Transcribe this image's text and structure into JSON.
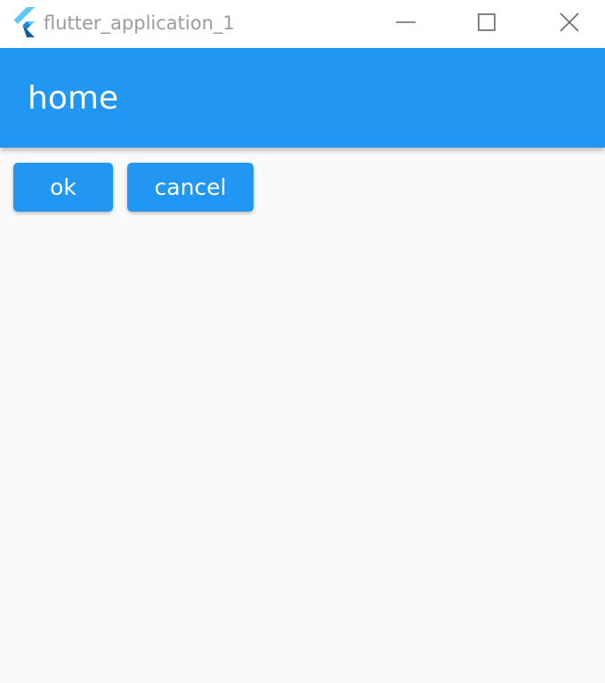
{
  "window": {
    "title": "flutter_application_1",
    "icon": "flutter-logo-icon",
    "controls": [
      "minimize-icon",
      "maximize-icon",
      "close-icon"
    ]
  },
  "appbar": {
    "title": "home"
  },
  "buttons": {
    "ok_label": "ok",
    "cancel_label": "cancel"
  },
  "colors": {
    "primary": "#2196f3",
    "background": "#fafafa",
    "title_text": "#9b9b9b",
    "on_primary": "#ffffff"
  }
}
